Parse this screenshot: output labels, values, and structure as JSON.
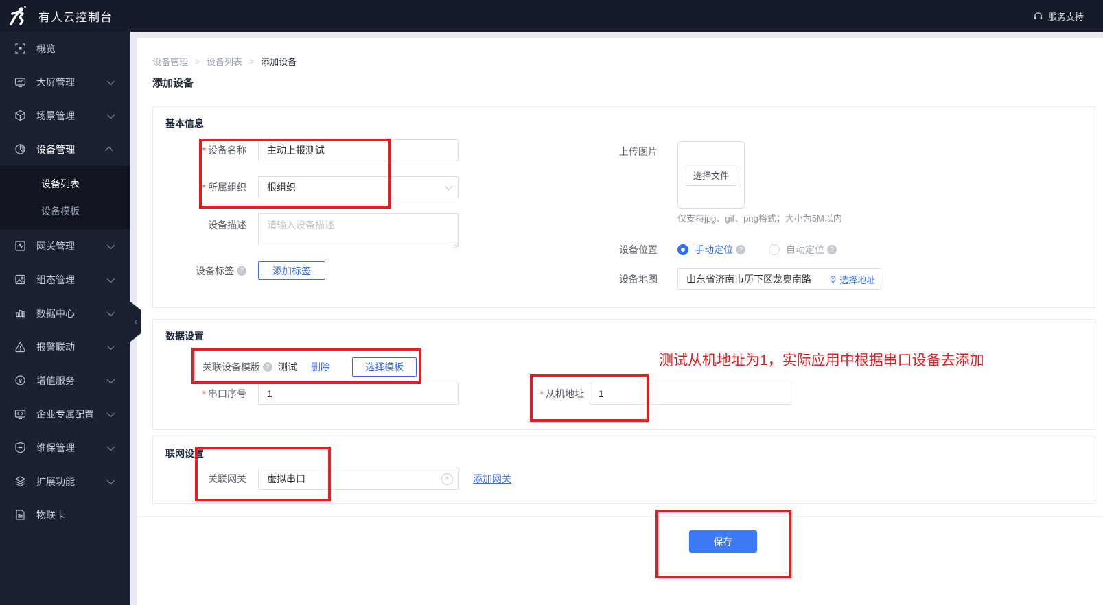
{
  "topbar": {
    "title": "有人云控制台",
    "support_label": "服务支持"
  },
  "sidebar": {
    "items": [
      {
        "label": "概览"
      },
      {
        "label": "大屏管理"
      },
      {
        "label": "场景管理"
      },
      {
        "label": "设备管理"
      },
      {
        "label": "网关管理"
      },
      {
        "label": "组态管理"
      },
      {
        "label": "数据中心"
      },
      {
        "label": "报警联动"
      },
      {
        "label": "增值服务"
      },
      {
        "label": "企业专属配置"
      },
      {
        "label": "维保管理"
      },
      {
        "label": "扩展功能"
      },
      {
        "label": "物联卡"
      }
    ],
    "submenu": [
      {
        "label": "设备列表"
      },
      {
        "label": "设备模板"
      }
    ]
  },
  "breadcrumb": {
    "items": [
      "设备管理",
      "设备列表",
      "添加设备"
    ],
    "separator": ">"
  },
  "page": {
    "title": "添加设备",
    "required_mark": "*"
  },
  "basic": {
    "title": "基本信息",
    "name_label": "设备名称",
    "name_value": "主动上报测试",
    "org_label": "所属组织",
    "org_value": "根组织",
    "desc_label": "设备描述",
    "desc_placeholder": "请输入设备描述",
    "tag_label": "设备标签",
    "add_tag_btn": "添加标签",
    "upload_label": "上传图片",
    "choose_file_btn": "选择文件",
    "upload_hint": "仅支持jpg、gif、png格式；大小为5M以内",
    "location_label": "设备位置",
    "manual_radio": "手动定位",
    "auto_radio": "自动定位",
    "map_label": "设备地图",
    "map_value": "山东省济南市历下区龙奥南路",
    "choose_address_link": "选择地址"
  },
  "data_settings": {
    "title": "数据设置",
    "template_label": "关联设备模版",
    "template_value": "测试",
    "delete_link": "删除",
    "select_template_btn": "选择模板",
    "serial_label": "串口序号",
    "serial_value": "1",
    "slave_label": "从机地址",
    "slave_value": "1"
  },
  "network": {
    "title": "联网设置",
    "gateway_label": "关联网关",
    "gateway_value": "虚拟串口",
    "add_gateway_link": "添加网关"
  },
  "footer": {
    "save_btn": "保存"
  },
  "annotation": {
    "text": "测试从机地址为1，实际应用中根据串口设备去添加",
    "color": "#e01f23"
  },
  "colors": {
    "accent_blue": "#3a6ff0",
    "save_blue": "#3d7bf5",
    "sidebar_bg": "#1a2130",
    "topbar_bg": "#151b28"
  }
}
